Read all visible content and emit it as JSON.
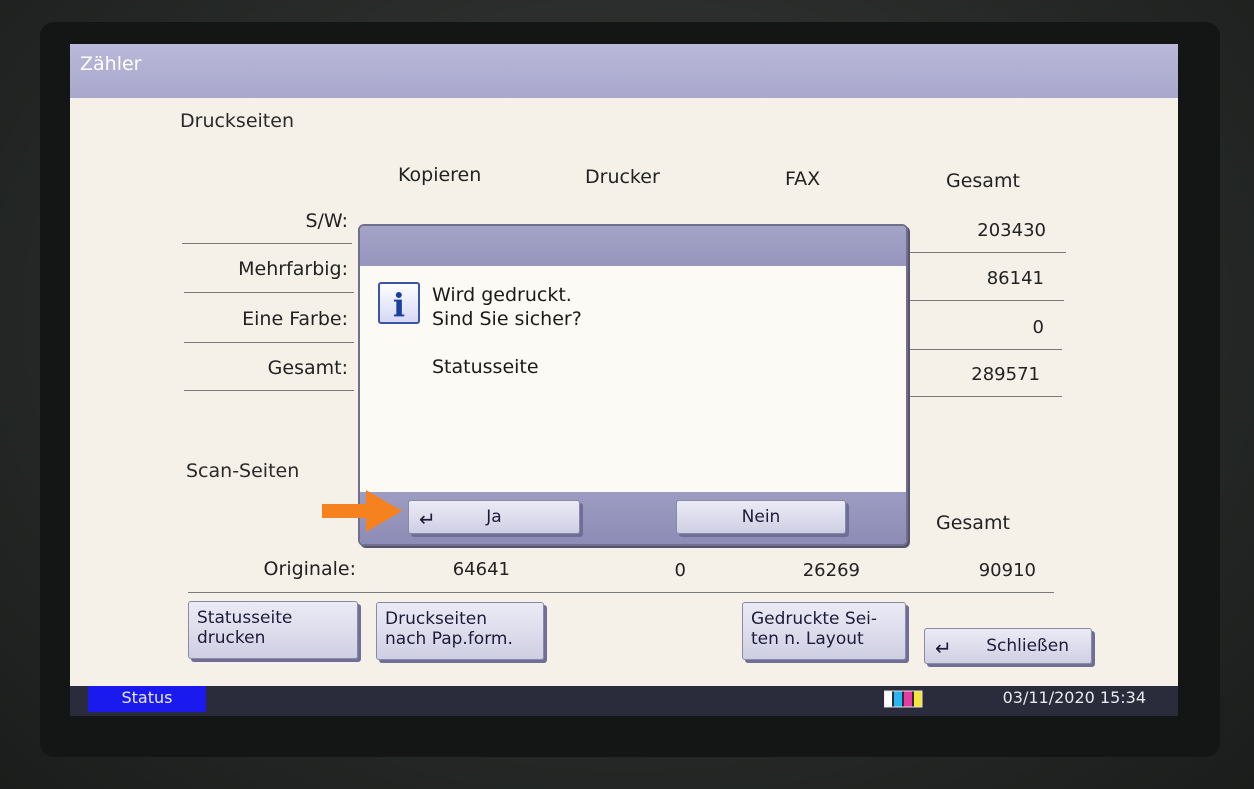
{
  "window": {
    "title": "Zähler"
  },
  "druckseiten": {
    "title": "Druckseiten",
    "columns": [
      "Kopieren",
      "Drucker",
      "FAX",
      "Gesamt"
    ],
    "rows": [
      {
        "label": "S/W:",
        "gesamt": "203430"
      },
      {
        "label": "Mehrfarbig:",
        "gesamt": "86141"
      },
      {
        "label": "Eine Farbe:",
        "gesamt": "0"
      },
      {
        "label": "Gesamt:",
        "gesamt": "289571"
      }
    ]
  },
  "scanseiten": {
    "title": "Scan-Seiten",
    "gesamt_header": "Gesamt",
    "row": {
      "label": "Originale:",
      "values": [
        "64641",
        "0",
        "26269",
        "90910"
      ]
    }
  },
  "buttons": {
    "statusseite": "Statusseite\ndrucken",
    "druckseiten_papform": "Druckseiten\nnach Pap.form.",
    "gedruckte_layout": "Gedruckte Sei-\nten n. Layout",
    "schliessen": "Schließen"
  },
  "dialog": {
    "message_line1": "Wird gedruckt.",
    "message_line2": "Sind Sie sicher?",
    "detail": "Statusseite",
    "yes": "Ja",
    "no": "Nein",
    "icon": "info-icon"
  },
  "statusbar": {
    "status": "Status",
    "datetime": "03/11/2020 15:34"
  },
  "colors": {
    "accent_arrow": "#f5821f",
    "status_button": "#1a1aee",
    "titlebar": "#b0afd3"
  }
}
